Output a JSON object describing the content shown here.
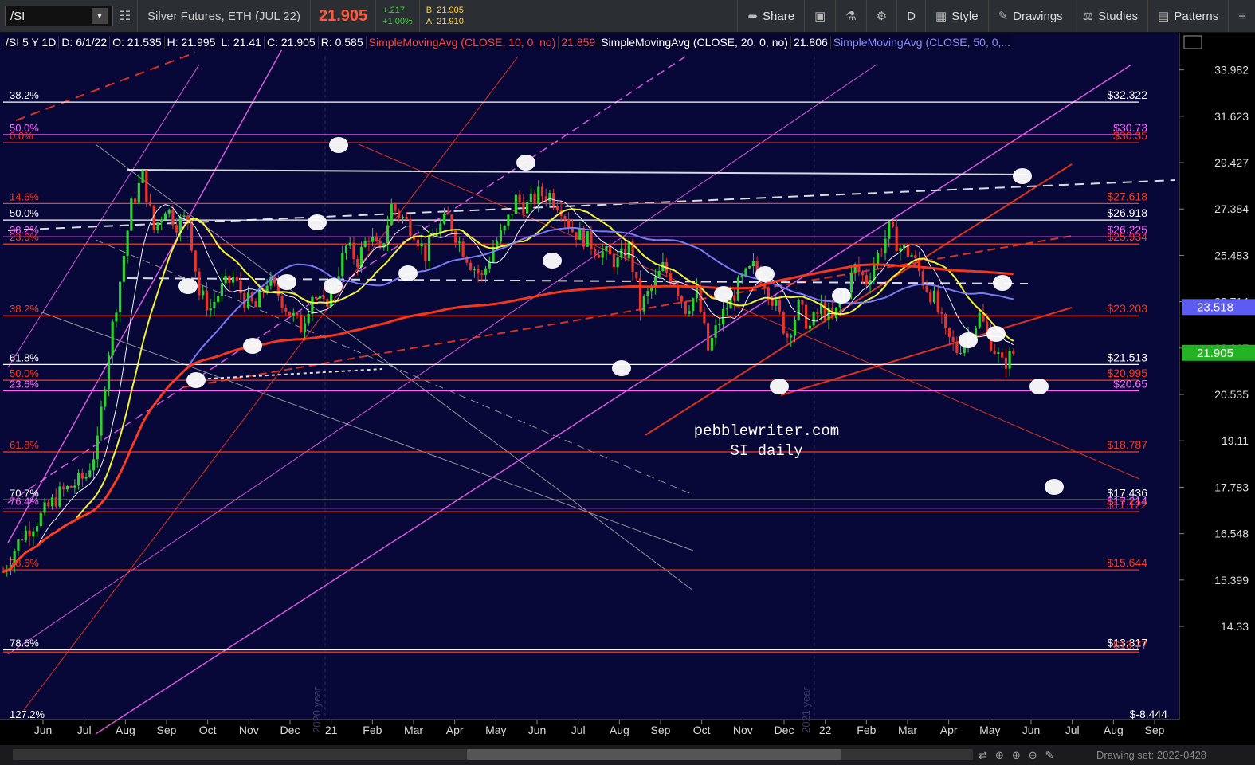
{
  "toolbar": {
    "symbol": "/SI",
    "description": "Silver Futures, ETH (JUL 22)",
    "last": "21.905",
    "change": "+.217",
    "change_pct": "+1.00%",
    "bid": "B: 21.905",
    "ask": "A: 21.910",
    "share": "Share",
    "period": "D",
    "style": "Style",
    "drawings": "Drawings",
    "studies": "Studies",
    "patterns": "Patterns"
  },
  "header": {
    "sym": "/SI 5 Y 1D",
    "date": "D: 6/1/22",
    "open": "O: 21.535",
    "high": "H: 21.995",
    "low": "L: 21.41",
    "close": "C: 21.905",
    "range": "R: 0.585",
    "sma10": "SimpleMovingAvg (CLOSE, 10, 0, no)",
    "sma10_val": "21.859",
    "sma20": "SimpleMovingAvg (CLOSE, 20, 0, no)",
    "sma20_val": "21.806",
    "sma50": "SimpleMovingAvg (CLOSE, 50, 0,..."
  },
  "watermark": {
    "line1": "pebblewriter.com",
    "line2": "SI daily"
  },
  "status": {
    "drawing_set": "Drawing set: 2022-0428"
  },
  "colors": {
    "bg": "#070738",
    "up": "#2fd02f",
    "down": "#e8352a",
    "fib_red": "#ff3a1a",
    "fib_magenta": "#ff66ff",
    "sma10": "#ffffff",
    "sma20": "#ffff33",
    "sma50": "#8080ff",
    "sma200": "#ff3a1a"
  },
  "chart_data": {
    "type": "candlestick",
    "y_axis": {
      "scale": "log",
      "range": [
        12.4,
        36.0
      ],
      "ticks": [
        "33.982",
        "31.623",
        "29.427",
        "27.384",
        "25.483",
        "23.714",
        "22.067",
        "20.535",
        "19.11",
        "17.783",
        "16.548",
        "15.399",
        "14.33"
      ]
    },
    "x_axis": {
      "labels": [
        "Jun",
        "Jul",
        "Aug",
        "Sep",
        "Oct",
        "Nov",
        "Dec",
        "21",
        "Feb",
        "Mar",
        "Apr",
        "May",
        "Jun",
        "Jul",
        "Aug",
        "Sep",
        "Oct",
        "Nov",
        "Dec",
        "22",
        "Feb",
        "Mar",
        "Apr",
        "May",
        "Jun",
        "Jul",
        "Aug",
        "Sep"
      ],
      "year_markers": [
        "2020 year",
        "2021 year"
      ]
    },
    "price_path": [
      [
        0,
        15.6
      ],
      [
        5,
        16.5
      ],
      [
        10,
        17.0
      ],
      [
        15,
        17.6
      ],
      [
        18,
        17.8
      ],
      [
        22,
        18.1
      ],
      [
        25,
        19.0
      ],
      [
        28,
        22.0
      ],
      [
        31,
        24.5
      ],
      [
        34,
        27.5
      ],
      [
        37,
        28.8
      ],
      [
        40,
        26.5
      ],
      [
        43,
        27.5
      ],
      [
        46,
        26.8
      ],
      [
        49,
        27.0
      ],
      [
        52,
        24.0
      ],
      [
        55,
        23.5
      ],
      [
        58,
        24.2
      ],
      [
        61,
        24.6
      ],
      [
        64,
        23.8
      ],
      [
        67,
        23.5
      ],
      [
        70,
        24.5
      ],
      [
        73,
        24.0
      ],
      [
        76,
        23.3
      ],
      [
        79,
        22.8
      ],
      [
        82,
        24.0
      ],
      [
        85,
        23.5
      ],
      [
        88,
        24.5
      ],
      [
        91,
        25.8
      ],
      [
        94,
        25.3
      ],
      [
        97,
        26.3
      ],
      [
        100,
        25.5
      ],
      [
        103,
        27.5
      ],
      [
        106,
        27.0
      ],
      [
        109,
        26.5
      ],
      [
        112,
        25.5
      ],
      [
        115,
        26.5
      ],
      [
        118,
        27.0
      ],
      [
        121,
        26.0
      ],
      [
        124,
        25.2
      ],
      [
        127,
        24.6
      ],
      [
        130,
        25.8
      ],
      [
        133,
        26.5
      ],
      [
        136,
        27.8
      ],
      [
        139,
        27.5
      ],
      [
        142,
        28.0
      ],
      [
        145,
        28.0
      ],
      [
        148,
        27.5
      ],
      [
        151,
        26.5
      ],
      [
        154,
        26.2
      ],
      [
        157,
        25.8
      ],
      [
        160,
        25.5
      ],
      [
        163,
        25.2
      ],
      [
        166,
        25.8
      ],
      [
        169,
        23.5
      ],
      [
        172,
        24.2
      ],
      [
        175,
        25.0
      ],
      [
        178,
        24.5
      ],
      [
        181,
        23.5
      ],
      [
        184,
        24.0
      ],
      [
        187,
        22.0
      ],
      [
        190,
        23.0
      ],
      [
        193,
        23.8
      ],
      [
        196,
        24.5
      ],
      [
        199,
        25.0
      ],
      [
        202,
        24.5
      ],
      [
        205,
        23.5
      ],
      [
        208,
        22.5
      ],
      [
        211,
        23.5
      ],
      [
        214,
        22.8
      ],
      [
        217,
        23.5
      ],
      [
        220,
        23.0
      ],
      [
        223,
        24.0
      ],
      [
        226,
        25.0
      ],
      [
        229,
        24.5
      ],
      [
        232,
        25.5
      ],
      [
        235,
        26.5
      ],
      [
        238,
        25.8
      ],
      [
        241,
        25.5
      ],
      [
        244,
        24.5
      ],
      [
        247,
        23.8
      ],
      [
        250,
        22.5
      ],
      [
        253,
        22.0
      ],
      [
        256,
        22.5
      ],
      [
        259,
        23.2
      ],
      [
        262,
        22.3
      ],
      [
        265,
        21.5
      ],
      [
        268,
        21.9
      ]
    ],
    "sma_periods": [
      10,
      20,
      50,
      200
    ],
    "last_price": "21.905",
    "last_sma50": "23.518",
    "fib_levels": [
      {
        "label": "38.2%",
        "value": 32.322,
        "price": "$32.322",
        "color": "#ffffff"
      },
      {
        "label": "50.0%",
        "value": 30.73,
        "price": "$30.73",
        "color": "#ff66ff"
      },
      {
        "label": "0.0%",
        "value": 30.35,
        "price": "$30.35",
        "color": "#ff3a1a"
      },
      {
        "label": "14.6%",
        "value": 27.618,
        "price": "$27.618",
        "color": "#ff3a1a"
      },
      {
        "label": "50.0%",
        "value": 26.918,
        "price": "$26.918",
        "color": "#ffffff"
      },
      {
        "label": "38.2%",
        "value": 26.225,
        "price": "$26.225",
        "color": "#ff66ff"
      },
      {
        "label": "23.6%",
        "value": 25.934,
        "price": "$25.934",
        "color": "#ff3a1a"
      },
      {
        "label": "38.2%",
        "value": 23.203,
        "price": "$23.203",
        "color": "#ff3a1a"
      },
      {
        "label": "61.8%",
        "value": 21.513,
        "price": "$21.513",
        "color": "#ffffff"
      },
      {
        "label": "50.0%",
        "value": 20.995,
        "price": "$20.995",
        "color": "#ff3a1a"
      },
      {
        "label": "23.6%",
        "value": 20.65,
        "price": "$20.65",
        "color": "#ff66ff"
      },
      {
        "label": "61.8%",
        "value": 18.787,
        "price": "$18.787",
        "color": "#ff3a1a"
      },
      {
        "label": "70.7%",
        "value": 17.436,
        "price": "$17.436",
        "color": "#ffffff"
      },
      {
        "label": "76.4%",
        "value": 17.214,
        "price": "$17.214",
        "color": "#ff66ff"
      },
      {
        "label": "",
        "value": 17.122,
        "price": "$17.122",
        "color": "#ff3a1a"
      },
      {
        "label": "78.6%",
        "value": 15.644,
        "price": "$15.644",
        "color": "#ff3a1a"
      },
      {
        "label": "78.6%",
        "value": 13.817,
        "price": "$13.817",
        "color": "#ffffff"
      },
      {
        "label": "",
        "value": 13.77,
        "price": "$13.77",
        "color": "#ff3a1a"
      },
      {
        "label": "127.2%",
        "value": -8.444,
        "price": "$-8.444",
        "color": "#ffffff"
      }
    ]
  }
}
